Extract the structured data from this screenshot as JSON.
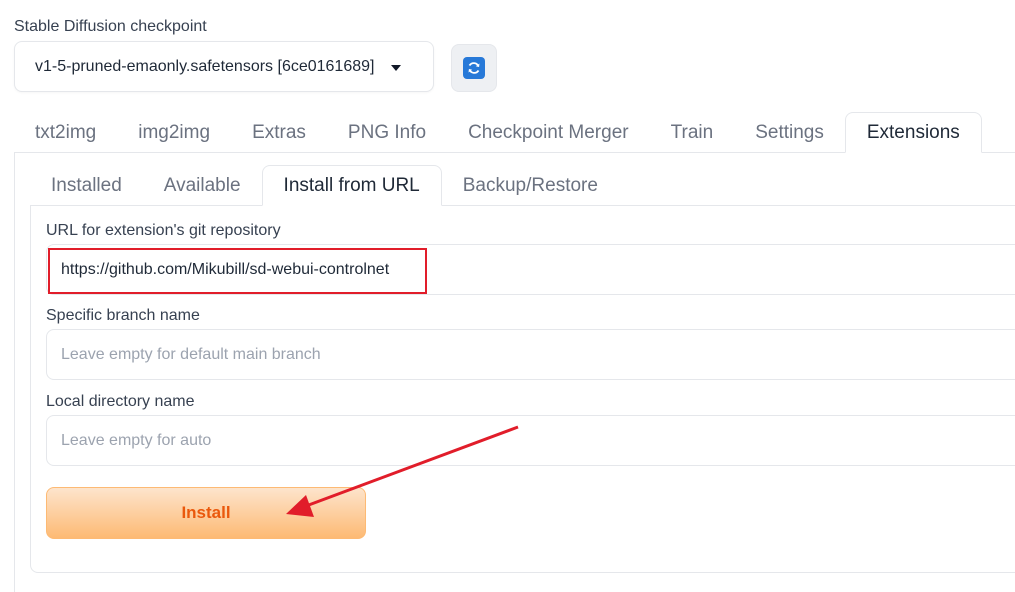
{
  "checkpoint": {
    "label": "Stable Diffusion checkpoint",
    "selected": "v1-5-pruned-emaonly.safetensors [6ce0161689]"
  },
  "main_tabs": [
    {
      "label": "txt2img"
    },
    {
      "label": "img2img"
    },
    {
      "label": "Extras"
    },
    {
      "label": "PNG Info"
    },
    {
      "label": "Checkpoint Merger"
    },
    {
      "label": "Train"
    },
    {
      "label": "Settings"
    },
    {
      "label": "Extensions",
      "active": true
    }
  ],
  "sub_tabs": [
    {
      "label": "Installed"
    },
    {
      "label": "Available"
    },
    {
      "label": "Install from URL",
      "active": true
    },
    {
      "label": "Backup/Restore"
    }
  ],
  "form": {
    "url_label": "URL for extension's git repository",
    "url_value": "https://github.com/Mikubill/sd-webui-controlnet",
    "branch_label": "Specific branch name",
    "branch_placeholder": "Leave empty for default main branch",
    "dir_label": "Local directory name",
    "dir_placeholder": "Leave empty for auto",
    "install_label": "Install"
  },
  "colors": {
    "highlight": "#e11d2a",
    "install_text": "#ea580c",
    "refresh_icon": "#2779d8"
  },
  "icons": {
    "refresh": "refresh-icon",
    "dropdown": "chevron-down-icon"
  }
}
